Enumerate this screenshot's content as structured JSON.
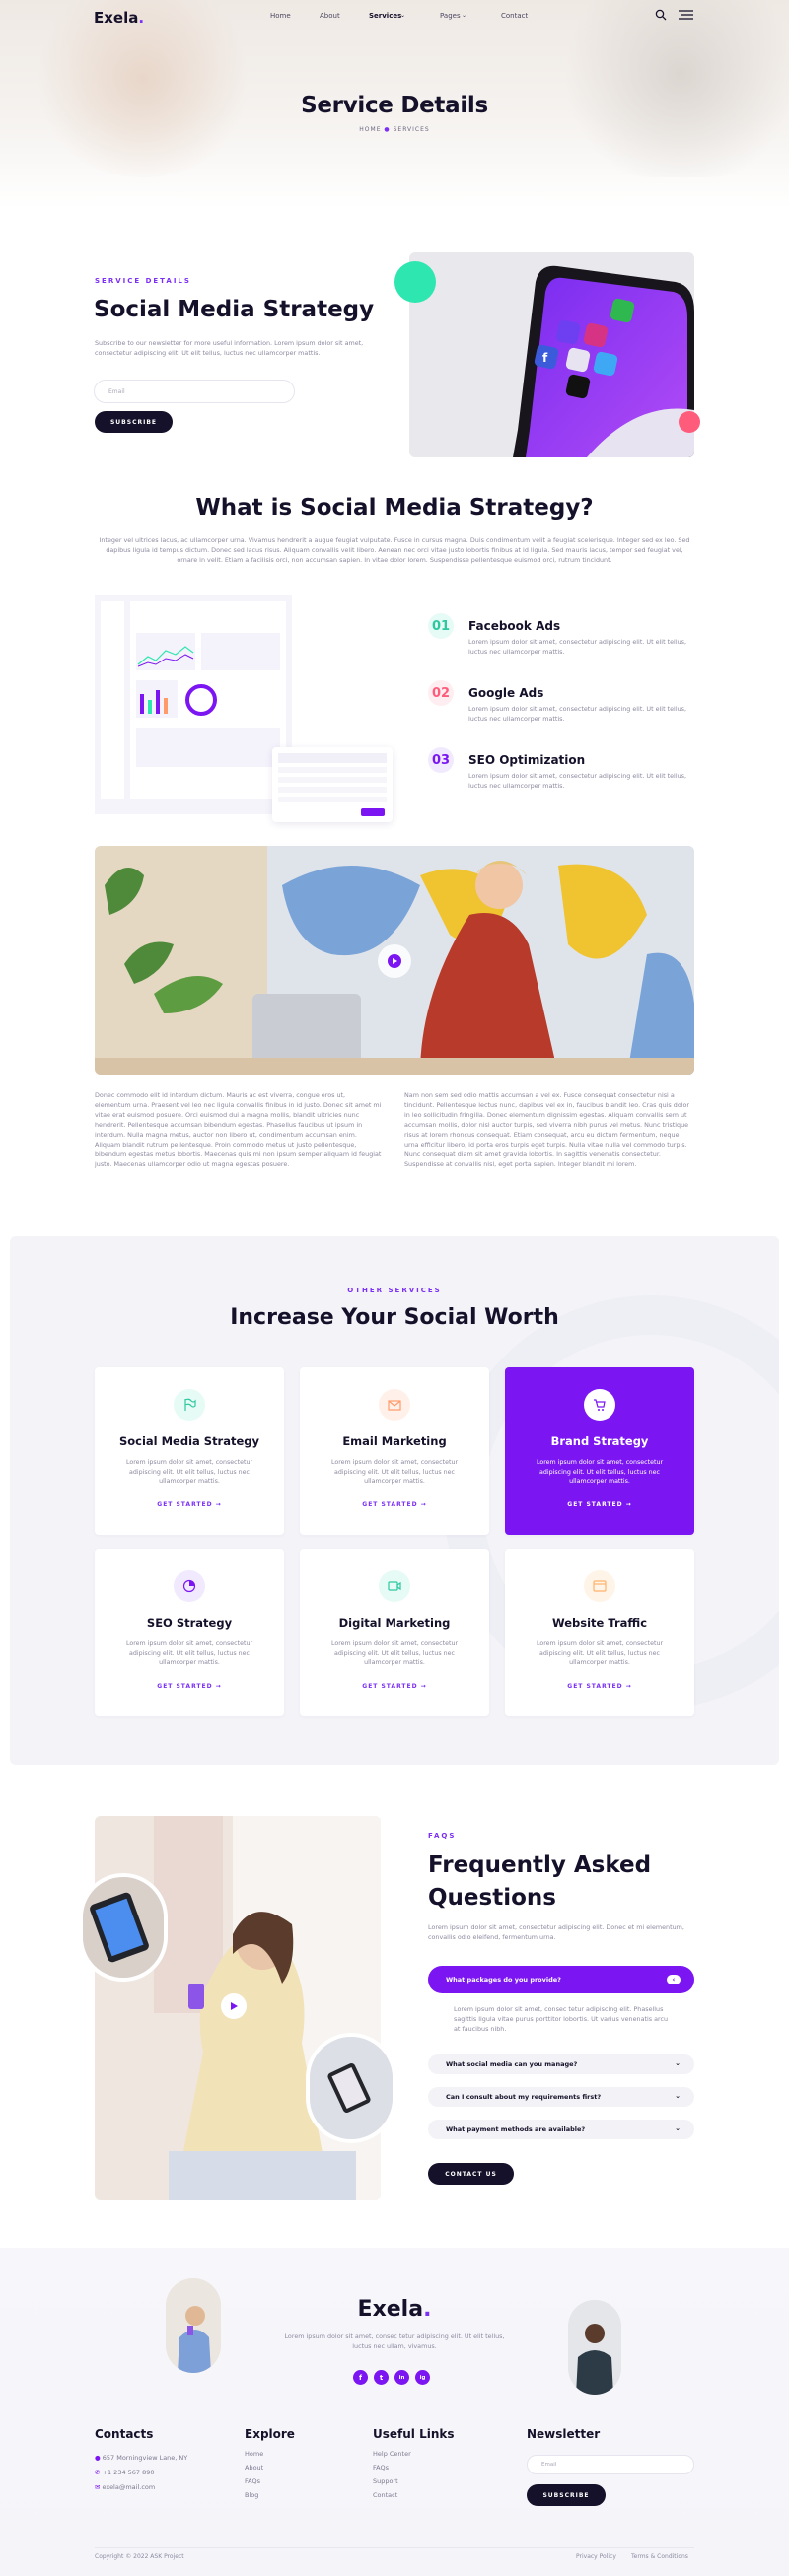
{
  "header": {
    "logo": "Exela",
    "nav": [
      "Home",
      "About",
      "Services",
      "Pages",
      "Contact"
    ],
    "title": "Service Details",
    "breadcrumb_home": "HOME",
    "breadcrumb_current": "SERVICES"
  },
  "intro": {
    "kicker": "SERVICE DETAILS",
    "title": "Social Media Strategy",
    "text": "Subscribe to our newsletter for more useful information. Lorem ipsum dolor sit amet, consectetur adipiscing elit. Ut elit tellus, luctus nec ullamcorper mattis.",
    "email_placeholder": "Email",
    "subscribe": "SUBSCRIBE"
  },
  "what": {
    "title": "What is Social Media Strategy?",
    "text": "Integer vel ultrices lacus, ac ullamcorper urna. Vivamus hendrerit a augue feugiat vulputate. Fusce in cursus magna. Duis condimentum velit a feugiat scelerisque. Integer sed ex leo. Sed dapibus ligula id tempus dictum. Donec sed lacus risus. Aliquam convallis velit libero. Aenean nec orci vitae justo lobortis finibus at id ligula. Sed mauris lacus, tempor sed feugiat vel, ornare in velit. Etiam a facilisis orci, non accumsan sapien. In vitae dolor lorem. Suspendisse pellentesque euismod orci, rutrum tincidunt.",
    "features": [
      {
        "num": "01",
        "title": "Facebook Ads",
        "text": "Lorem ipsum dolor sit amet, consectetur adipiscing elit. Ut elit tellus, luctus nec ullamcorper mattis."
      },
      {
        "num": "02",
        "title": "Google Ads",
        "text": "Lorem ipsum dolor sit amet, consectetur adipiscing elit. Ut elit tellus, luctus nec ullamcorper mattis."
      },
      {
        "num": "03",
        "title": "SEO Optimization",
        "text": "Lorem ipsum dolor sit amet, consectetur adipiscing elit. Ut elit tellus, luctus nec ullamcorper mattis."
      }
    ],
    "para_left": "Donec commodo elit id interdum dictum. Mauris ac est viverra, congue eros ut, elementum urna. Praesent vel leo nec ligula convallis finibus in id justo. Donec sit amet mi vitae erat euismod posuere. Orci euismod dui a magna mollis, blandit ultricies nunc hendrerit. Pellentesque accumsan bibendum egestas. Phasellus faucibus ut ipsum in interdum. Nulla magna metus, auctor non libero ut, condimentum accumsan enim. Aliquam blandit rutrum pellentesque. Proin commodo metus ut justo pellentesque, bibendum egestas metus lobortis. Maecenas quis mi non ipsum semper aliquam id feugiat justo. Maecenas ullamcorper odio ut magna egestas posuere.",
    "para_right": "Nam non sem sed odio mattis accumsan a vel ex. Fusce consequat consectetur nisi a tincidunt. Pellentesque lectus nunc, dapibus vel ex in, faucibus blandit leo. Cras quis dolor in leo sollicitudin fringilla. Donec elementum dignissim egestas. Aliquam convallis sem ut accumsan mollis, dolor nisl auctor turpis, sed viverra nibh purus vel metus. Nunc tristique risus at lorem rhoncus consequat. Etiam consequat, arcu eu dictum fermentum, neque urna efficitur libero, id porta eros turpis eget turpis. Nulla vitae nulla vel commodo turpis. Nunc consequat diam sit amet gravida lobortis. In sagittis venenatis consectetur. Suspendisse at convallis nisl, eget porta sapien. Integer blandit mi lorem."
  },
  "other": {
    "kicker": "OTHER SERVICES",
    "title": "Increase Your Social Worth",
    "desc": "Lorem ipsum dolor sit amet, consectetur adipiscing elit. Ut elit tellus, luctus nec ullamcorper mattis.",
    "cta": "GET STARTED",
    "cards": [
      {
        "title": "Social Media Strategy",
        "icon": "flag-icon",
        "color": "#2ee6b0"
      },
      {
        "title": "Email Marketing",
        "icon": "mail-icon",
        "color": "#ff9b6b"
      },
      {
        "title": "Brand Strategy",
        "icon": "cart-icon",
        "color": "#7b16f2"
      },
      {
        "title": "SEO Strategy",
        "icon": "pie-chart-icon",
        "color": "#7b16f2"
      },
      {
        "title": "Digital Marketing",
        "icon": "video-icon",
        "color": "#2ee6b0"
      },
      {
        "title": "Website Traffic",
        "icon": "browser-icon",
        "color": "#ffb26b"
      }
    ]
  },
  "faq": {
    "kicker": "FAQS",
    "title_line1": "Frequently Asked",
    "title_line2": "Questions",
    "intro": "Lorem ipsum dolor sit amet, consectetur adipiscing elit. Donec et mi elementum, convallis odio eleifend, fermentum urna.",
    "items": [
      {
        "q": "What packages do you provide?",
        "a": "Lorem ipsum dolor sit amet, consec tetur adipiscing elit. Phasellus sagittis ligula vitae purus porttitor lobortis. Ut varius venenatis arcu at faucibus nibh."
      },
      {
        "q": "What social media can you manage?"
      },
      {
        "q": "Can I consult about my requirements first?"
      },
      {
        "q": "What payment methods are available?"
      }
    ],
    "contact": "CONTACT US"
  },
  "footer": {
    "logo": "Exela",
    "text": "Lorem ipsum dolor sit amet, consec tetur adipiscing elit. Ut elit tellus, luctus nec ullam, vivamus.",
    "social": [
      "f",
      "t",
      "in",
      "ig"
    ],
    "contacts_title": "Contacts",
    "address": "657 Morningview Lane, NY",
    "phone": "+1 234 567 890",
    "email": "exela@mail.com",
    "explore_title": "Explore",
    "explore": [
      "Home",
      "About",
      "FAQs",
      "Blog"
    ],
    "links_title": "Useful Links",
    "links": [
      "Help Center",
      "FAQs",
      "Support",
      "Contact"
    ],
    "news_title": "Newsletter",
    "news_placeholder": "Email",
    "news_btn": "SUBSCRIBE",
    "copyright": "Copyright © 2022 ASK Project",
    "privacy": "Privacy Policy",
    "terms": "Terms & Conditions"
  }
}
